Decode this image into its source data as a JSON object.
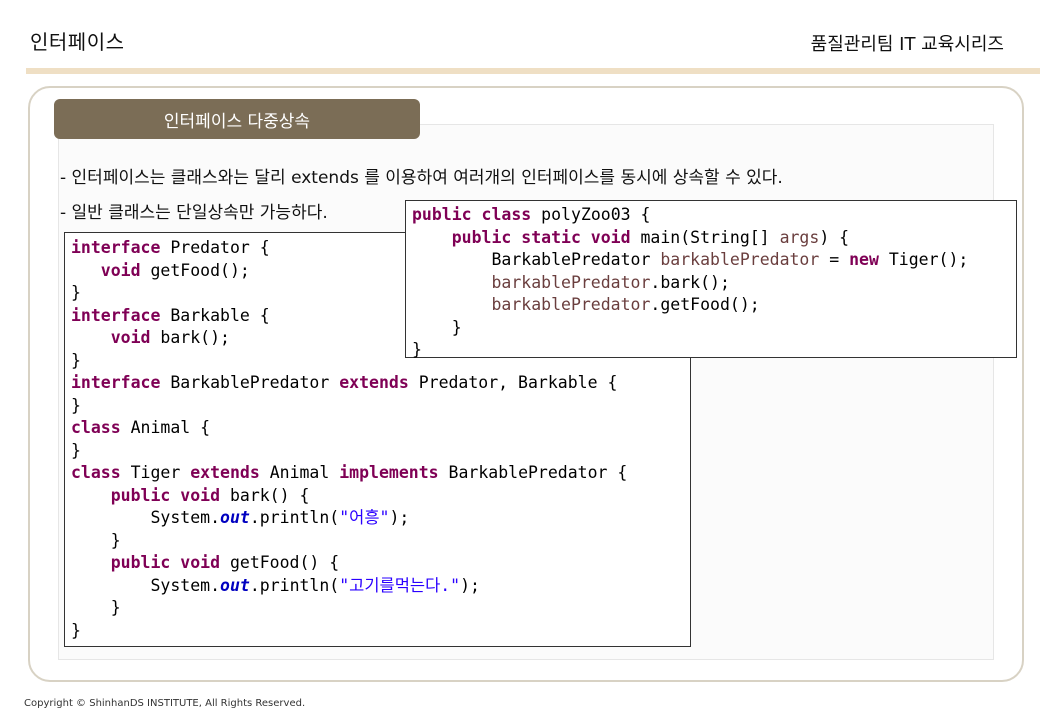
{
  "header": {
    "title": "인터페이스",
    "series": "품질관리팀 IT 교육시리즈"
  },
  "section": {
    "tab_label": "인터페이스 다중상속"
  },
  "bullets": [
    "- 인터페이스는 클래스와는 달리 extends 를 이용하여 여러개의 인터페이스를 동시에 상속할 수 있다.",
    "- 일반 클래스는 단일상속만 가능하다."
  ],
  "code_left": {
    "lines": [
      [
        {
          "t": "interface",
          "c": "kw"
        },
        {
          "t": " Predator {",
          "c": "pl"
        }
      ],
      [
        {
          "t": "   void",
          "c": "kw"
        },
        {
          "t": " getFood();",
          "c": "pl"
        }
      ],
      [
        {
          "t": "}",
          "c": "pl"
        }
      ],
      [
        {
          "t": "interface",
          "c": "kw"
        },
        {
          "t": " Barkable {",
          "c": "pl"
        }
      ],
      [
        {
          "t": "    void",
          "c": "kw"
        },
        {
          "t": " bark();",
          "c": "pl"
        }
      ],
      [
        {
          "t": "}",
          "c": "pl"
        }
      ],
      [
        {
          "t": "interface",
          "c": "kw"
        },
        {
          "t": " BarkablePredator ",
          "c": "pl"
        },
        {
          "t": "extends",
          "c": "kw"
        },
        {
          "t": " Predator, Barkable {",
          "c": "pl"
        }
      ],
      [
        {
          "t": "}",
          "c": "pl"
        }
      ],
      [
        {
          "t": "class",
          "c": "kw"
        },
        {
          "t": " Animal {",
          "c": "pl"
        }
      ],
      [
        {
          "t": "}",
          "c": "pl"
        }
      ],
      [
        {
          "t": "class",
          "c": "kw"
        },
        {
          "t": " Tiger ",
          "c": "pl"
        },
        {
          "t": "extends",
          "c": "kw"
        },
        {
          "t": " Animal ",
          "c": "pl"
        },
        {
          "t": "implements",
          "c": "kw"
        },
        {
          "t": " BarkablePredator {",
          "c": "pl"
        }
      ],
      [
        {
          "t": "    public void",
          "c": "kw"
        },
        {
          "t": " bark() {",
          "c": "pl"
        }
      ],
      [
        {
          "t": "        System.",
          "c": "pl"
        },
        {
          "t": "out",
          "c": "fld"
        },
        {
          "t": ".println(",
          "c": "pl"
        },
        {
          "t": "\"어흥\"",
          "c": "str"
        },
        {
          "t": ");",
          "c": "pl"
        }
      ],
      [
        {
          "t": "    }",
          "c": "pl"
        }
      ],
      [
        {
          "t": "    public void",
          "c": "kw"
        },
        {
          "t": " getFood() {",
          "c": "pl"
        }
      ],
      [
        {
          "t": "        System.",
          "c": "pl"
        },
        {
          "t": "out",
          "c": "fld"
        },
        {
          "t": ".println(",
          "c": "pl"
        },
        {
          "t": "\"고기를먹는다.\"",
          "c": "str"
        },
        {
          "t": ");",
          "c": "pl"
        }
      ],
      [
        {
          "t": "    }",
          "c": "pl"
        }
      ],
      [
        {
          "t": "}",
          "c": "pl"
        }
      ]
    ]
  },
  "code_right": {
    "lines": [
      [
        {
          "t": "public class",
          "c": "kw"
        },
        {
          "t": " polyZoo03 {",
          "c": "pl"
        }
      ],
      [
        {
          "t": "    public static void",
          "c": "kw"
        },
        {
          "t": " main(String[] ",
          "c": "pl"
        },
        {
          "t": "args",
          "c": "var"
        },
        {
          "t": ") {",
          "c": "pl"
        }
      ],
      [
        {
          "t": "        BarkablePredator ",
          "c": "pl"
        },
        {
          "t": "barkablePredator",
          "c": "var"
        },
        {
          "t": " = ",
          "c": "pl"
        },
        {
          "t": "new",
          "c": "kw"
        },
        {
          "t": " Tiger();",
          "c": "pl"
        }
      ],
      [
        {
          "t": "        barkablePredator",
          "c": "var"
        },
        {
          "t": ".bark();",
          "c": "pl"
        }
      ],
      [
        {
          "t": "        barkablePredator",
          "c": "var"
        },
        {
          "t": ".getFood();",
          "c": "pl"
        }
      ],
      [
        {
          "t": "    }",
          "c": "pl"
        }
      ],
      [
        {
          "t": "}",
          "c": "pl"
        }
      ]
    ]
  },
  "footer": {
    "copyright": "Copyright © ShinhanDS INSTITUTE, All Rights Reserved."
  }
}
